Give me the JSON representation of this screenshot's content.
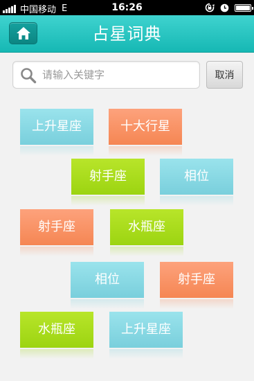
{
  "status_bar": {
    "carrier": "中国移动",
    "network": "E",
    "time": "16:26"
  },
  "header": {
    "title": "占星词典",
    "home_icon": "home-icon"
  },
  "search": {
    "placeholder": "请输入关键字",
    "value": "",
    "cancel_label": "取消"
  },
  "tags": [
    {
      "label": "上升星座",
      "color": "#79cfdc"
    },
    {
      "label": "十大行星",
      "color": "#f58653"
    },
    {
      "label": "射手座",
      "color": "#9cd411"
    },
    {
      "label": "相位",
      "color": "#79cfdc"
    },
    {
      "label": "射手座",
      "color": "#f58653"
    },
    {
      "label": "水瓶座",
      "color": "#9cd411"
    },
    {
      "label": "相位",
      "color": "#79cfdc"
    },
    {
      "label": "射手座",
      "color": "#f58653"
    },
    {
      "label": "水瓶座",
      "color": "#9cd411"
    },
    {
      "label": "上升星座",
      "color": "#79cfdc"
    }
  ]
}
